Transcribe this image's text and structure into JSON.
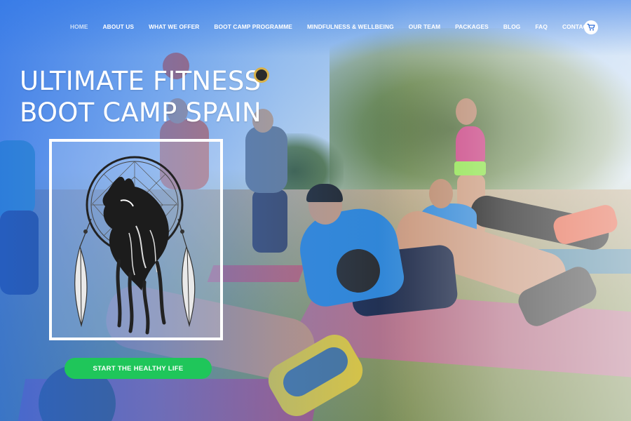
{
  "nav": {
    "items": [
      {
        "label": "HOME",
        "active": true
      },
      {
        "label": "ABOUT US"
      },
      {
        "label": "WHAT WE OFFER"
      },
      {
        "label": "BOOT CAMP PROGRAMME"
      },
      {
        "label": "MINDFULNESS & WELLBEING"
      },
      {
        "label": "OUR TEAM"
      },
      {
        "label": "PACKAGES"
      },
      {
        "label": "BLOG"
      },
      {
        "label": "FAQ"
      },
      {
        "label": "CONTACT"
      }
    ],
    "cart_icon": "shopping-cart-icon"
  },
  "hero": {
    "title_line1": "ULTIMATE FITNESS",
    "title_line2": "BOOT CAMP SPAIN",
    "logo": "wolf-dreamcatcher-logo",
    "cta_label": "START THE HEALTHY LIFE"
  },
  "colors": {
    "overlay_blue": "#2e6ee6",
    "cta_green": "#1fc65a",
    "text_white": "#ffffff"
  }
}
